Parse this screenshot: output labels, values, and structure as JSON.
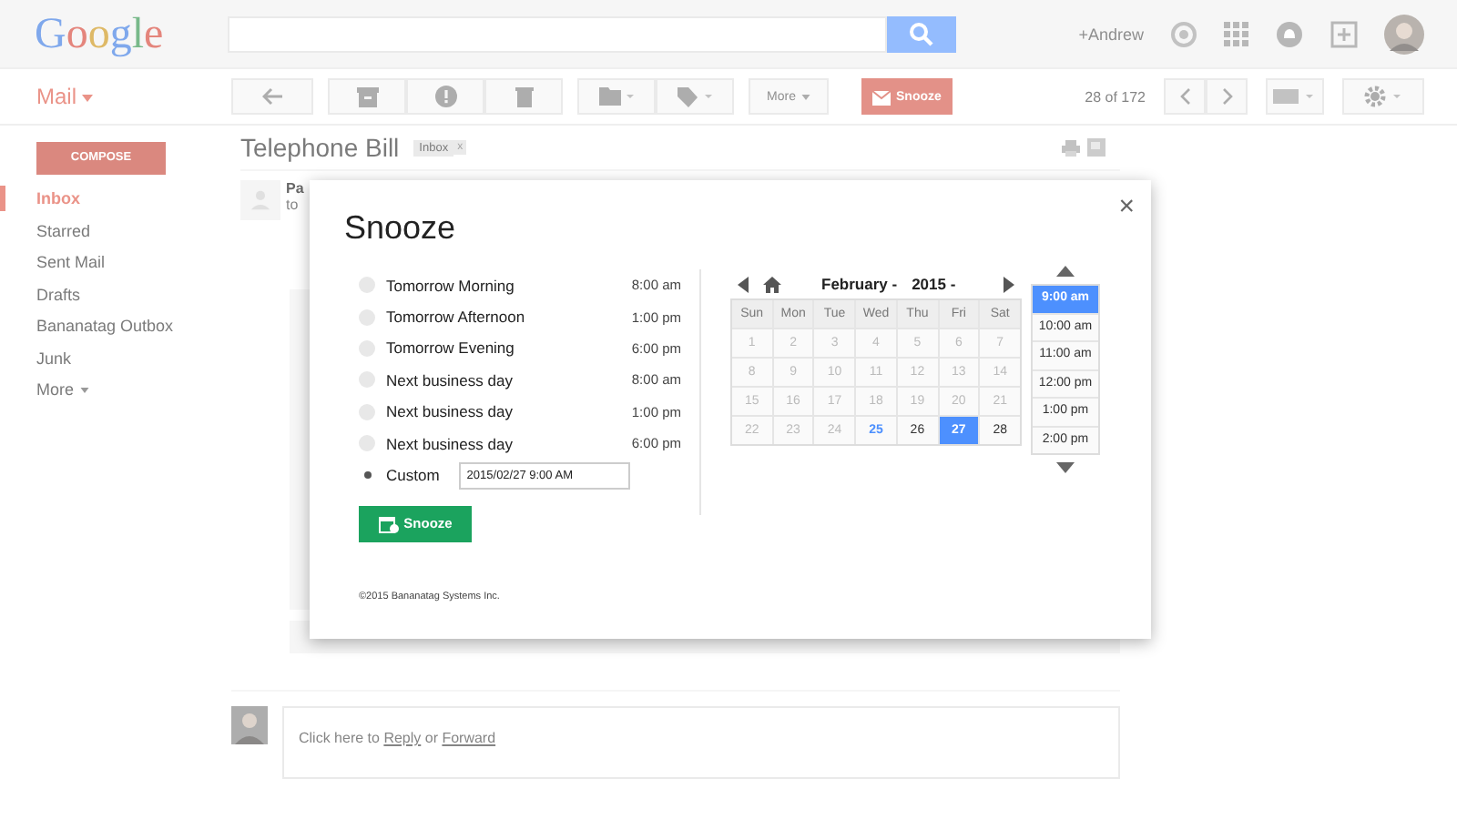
{
  "header": {
    "logo": "Google",
    "user_link": "+Andrew"
  },
  "toolbar": {
    "app_menu": "Mail",
    "more_button": "More",
    "snooze_button": "Snooze",
    "page_count": "28 of 172"
  },
  "sidebar": {
    "compose": "COMPOSE",
    "items": [
      {
        "label": "Inbox",
        "selected": true
      },
      {
        "label": "Starred",
        "selected": false
      },
      {
        "label": "Sent Mail",
        "selected": false
      },
      {
        "label": "Drafts",
        "selected": false
      },
      {
        "label": "Bananatag Outbox",
        "selected": false
      },
      {
        "label": "Junk",
        "selected": false
      }
    ],
    "more": "More"
  },
  "message": {
    "subject": "Telephone Bill",
    "label": "Inbox",
    "label_remove": "x",
    "sender_name": "Pa",
    "sender_to": "to"
  },
  "reply": {
    "prefix": "Click here to ",
    "reply_link": "Reply",
    "middle": " or ",
    "forward_link": "Forward"
  },
  "dialog": {
    "title": "Snooze",
    "close": "×",
    "options": [
      {
        "label": "Tomorrow Morning",
        "time": "8:00 am",
        "selected": false
      },
      {
        "label": "Tomorrow Afternoon",
        "time": "1:00 pm",
        "selected": false
      },
      {
        "label": "Tomorrow Evening",
        "time": "6:00 pm",
        "selected": false
      },
      {
        "label": "Next business day",
        "time": "8:00 am",
        "selected": false
      },
      {
        "label": "Next business day",
        "time": "1:00 pm",
        "selected": false
      },
      {
        "label": "Next business day",
        "time": "6:00 pm",
        "selected": false
      },
      {
        "label": "Custom",
        "value": "2015/02/27 9:00 AM",
        "selected": true
      }
    ],
    "snooze_button": "Snooze",
    "copyright": "©2015 Bananatag Systems Inc.",
    "calendar": {
      "month": "February -",
      "year": "2015 -",
      "weekdays": [
        "Sun",
        "Mon",
        "Tue",
        "Wed",
        "Thu",
        "Fri",
        "Sat"
      ],
      "weeks": [
        [
          {
            "day": "1",
            "disabled": true,
            "today": false,
            "selected": false
          },
          {
            "day": "2",
            "disabled": true,
            "today": false,
            "selected": false
          },
          {
            "day": "3",
            "disabled": true,
            "today": false,
            "selected": false
          },
          {
            "day": "4",
            "disabled": true,
            "today": false,
            "selected": false
          },
          {
            "day": "5",
            "disabled": true,
            "today": false,
            "selected": false
          },
          {
            "day": "6",
            "disabled": true,
            "today": false,
            "selected": false
          },
          {
            "day": "7",
            "disabled": true,
            "today": false,
            "selected": false
          }
        ],
        [
          {
            "day": "8",
            "disabled": true,
            "today": false,
            "selected": false
          },
          {
            "day": "9",
            "disabled": true,
            "today": false,
            "selected": false
          },
          {
            "day": "10",
            "disabled": true,
            "today": false,
            "selected": false
          },
          {
            "day": "11",
            "disabled": true,
            "today": false,
            "selected": false
          },
          {
            "day": "12",
            "disabled": true,
            "today": false,
            "selected": false
          },
          {
            "day": "13",
            "disabled": true,
            "today": false,
            "selected": false
          },
          {
            "day": "14",
            "disabled": true,
            "today": false,
            "selected": false
          }
        ],
        [
          {
            "day": "15",
            "disabled": true,
            "today": false,
            "selected": false
          },
          {
            "day": "16",
            "disabled": true,
            "today": false,
            "selected": false
          },
          {
            "day": "17",
            "disabled": true,
            "today": false,
            "selected": false
          },
          {
            "day": "18",
            "disabled": true,
            "today": false,
            "selected": false
          },
          {
            "day": "19",
            "disabled": true,
            "today": false,
            "selected": false
          },
          {
            "day": "20",
            "disabled": true,
            "today": false,
            "selected": false
          },
          {
            "day": "21",
            "disabled": true,
            "today": false,
            "selected": false
          }
        ],
        [
          {
            "day": "22",
            "disabled": true,
            "today": false,
            "selected": false
          },
          {
            "day": "23",
            "disabled": true,
            "today": false,
            "selected": false
          },
          {
            "day": "24",
            "disabled": true,
            "today": false,
            "selected": false
          },
          {
            "day": "25",
            "disabled": false,
            "today": true,
            "selected": false
          },
          {
            "day": "26",
            "disabled": false,
            "today": false,
            "selected": false
          },
          {
            "day": "27",
            "disabled": false,
            "today": false,
            "selected": true
          },
          {
            "day": "28",
            "disabled": false,
            "today": false,
            "selected": false
          }
        ]
      ]
    },
    "times": [
      {
        "label": "9:00 am",
        "selected": true
      },
      {
        "label": "10:00 am",
        "selected": false
      },
      {
        "label": "11:00 am",
        "selected": false
      },
      {
        "label": "12:00 pm",
        "selected": false
      },
      {
        "label": "1:00 pm",
        "selected": false
      },
      {
        "label": "2:00 pm",
        "selected": false
      }
    ]
  }
}
